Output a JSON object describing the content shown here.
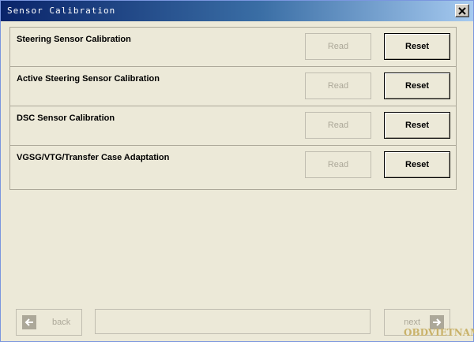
{
  "window": {
    "title": "Sensor Calibration"
  },
  "rows": [
    {
      "label": "Steering Sensor Calibration",
      "read_label": "Read",
      "reset_label": "Reset"
    },
    {
      "label": "Active Steering Sensor Calibration",
      "read_label": "Read",
      "reset_label": "Reset"
    },
    {
      "label": "DSC Sensor Calibration",
      "read_label": "Read",
      "reset_label": "Reset"
    },
    {
      "label": "VGSG/VTG/Transfer Case Adaptation",
      "read_label": "Read",
      "reset_label": "Reset"
    }
  ],
  "footer": {
    "back_label": "back",
    "next_label": "next",
    "status_text": "",
    "watermark": "OBDVIETNAM"
  },
  "icons": {
    "close": "close-icon",
    "back": "arrow-left-icon",
    "next": "arrow-right-icon"
  },
  "colors": {
    "title_bar_start": "#0a246a",
    "title_bar_end": "#a6caf0",
    "window_bg": "#ece9d8",
    "disabled_text": "#aca899",
    "watermark": "#c9b26a"
  }
}
